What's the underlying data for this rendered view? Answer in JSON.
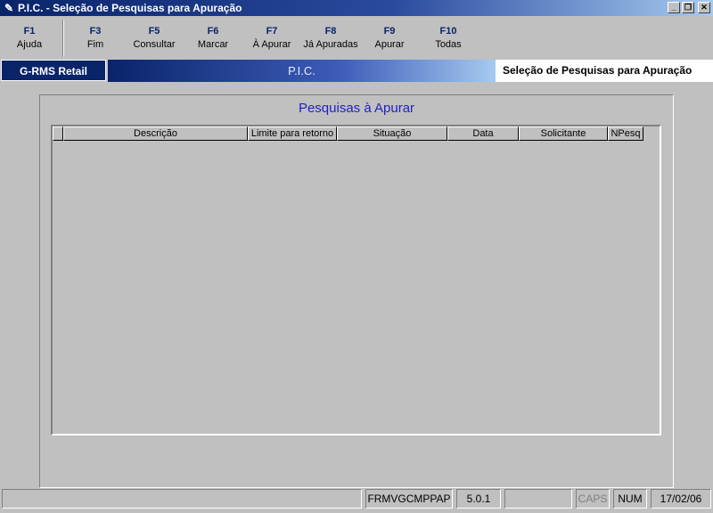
{
  "window": {
    "title": "P.I.C. - Seleção de Pesquisas para Apuração",
    "app_icon": "pen-icon",
    "controls": [
      "minimize-icon",
      "restore-icon",
      "close-icon"
    ]
  },
  "toolbar": {
    "keys": [
      {
        "key": "F1",
        "label": "Ajuda"
      },
      {
        "key": "F3",
        "label": "Fim"
      },
      {
        "key": "F5",
        "label": "Consultar"
      },
      {
        "key": "F6",
        "label": "Marcar"
      },
      {
        "key": "F7",
        "label": "À Apurar"
      },
      {
        "key": "F8",
        "label": "Já Apuradas"
      },
      {
        "key": "F9",
        "label": "Apurar"
      },
      {
        "key": "F10",
        "label": "Todas"
      }
    ]
  },
  "banner": {
    "brand": "G-RMS Retail",
    "module": "P.I.C.",
    "screen": "Seleção de Pesquisas para Apuração"
  },
  "panel": {
    "title": "Pesquisas à Apurar",
    "columns": [
      "",
      "Descrição",
      "Limite para retorno",
      "Situação",
      "Data",
      "Solicitante",
      "NPesq"
    ]
  },
  "statusbar": {
    "message": "",
    "form": "FRMVGCMPPAP",
    "version": "5.0.1",
    "blank": "",
    "caps": "CAPS",
    "num": "NUM",
    "date": "17/02/06"
  },
  "colors": {
    "title_bar": "#0a246a",
    "function_key": "#0a246a",
    "panel_title": "#1f1fc8",
    "background": "#c0c0c0"
  }
}
